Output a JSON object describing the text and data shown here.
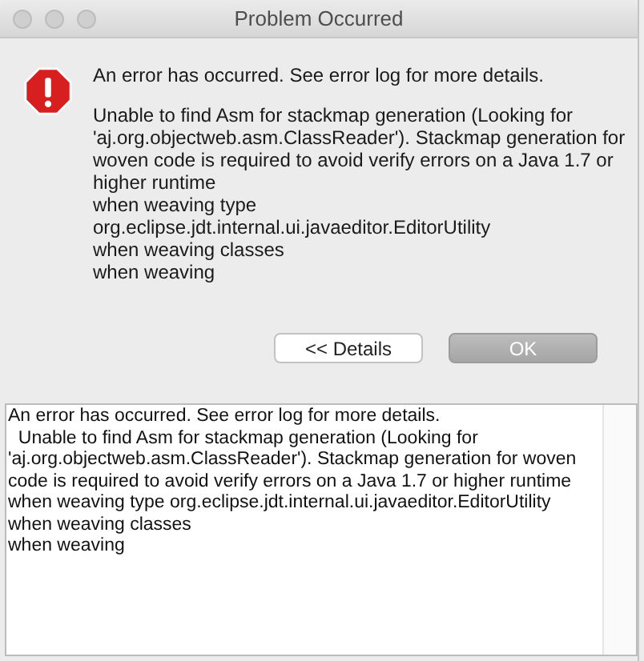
{
  "window": {
    "title": "Problem Occurred"
  },
  "message": {
    "summary": "An error has occurred. See error log for more details.",
    "lines": [
      "Unable to find Asm for stackmap generation (Looking for",
      "'aj.org.objectweb.asm.ClassReader'). Stackmap generation for",
      "woven code is required to avoid verify errors on a Java 1.7 or",
      "higher runtime",
      "when weaving type",
      "org.eclipse.jdt.internal.ui.javaeditor.EditorUtility",
      "when weaving classes",
      "when weaving"
    ]
  },
  "buttons": [
    {
      "label": "<< Details",
      "kind": "secondary"
    },
    {
      "label": "OK",
      "kind": "default"
    }
  ],
  "details": {
    "lines": [
      "An error has occurred. See error log for more details.",
      "  Unable to find Asm for stackmap generation (Looking for",
      "'aj.org.objectweb.asm.ClassReader'). Stackmap generation for woven",
      "code is required to avoid verify errors on a Java 1.7 or higher runtime",
      "when weaving type org.eclipse.jdt.internal.ui.javaeditor.EditorUtility",
      "when weaving classes",
      "when weaving"
    ]
  }
}
